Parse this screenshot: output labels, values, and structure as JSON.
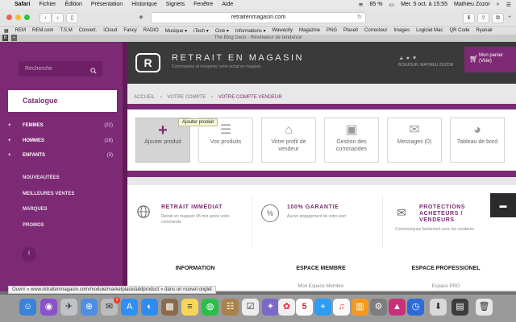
{
  "menubar": {
    "app": "Safari",
    "items": [
      "Fichier",
      "Édition",
      "Présentation",
      "Historique",
      "Signets",
      "Fenêtre",
      "Aide"
    ],
    "battery": "85 %",
    "clock": "Mer. 5 oct. à 15:55",
    "user": "Mathieu Zozor"
  },
  "browser": {
    "url": "retraitenmagasin.com",
    "tab_title": "The Blog Deco - Révélateur de tendance",
    "bookmarks": [
      "REM",
      "REM.com",
      "T.S.M",
      "Convert.",
      "iCloud",
      "Fancy",
      "RADIO",
      "Musique ▾",
      "iTech ▾",
      "Ciné ▾",
      "Informations ▾",
      "Wawacity",
      "Magazine",
      "PNG",
      "Placeit",
      "Correcteur",
      "Images",
      "Logiciel Mac",
      "QR Code",
      "Ryanair"
    ]
  },
  "sidebar": {
    "search_placeholder": "Recherche",
    "catalogue": "Catalogue",
    "categories": [
      {
        "label": "FEMMES",
        "count": "(22)"
      },
      {
        "label": "HOMMES",
        "count": "(16)"
      },
      {
        "label": "ENFANTS",
        "count": "(3)"
      }
    ],
    "links": [
      "NOUVEAUTÉES",
      "MEILLEURES VENTES",
      "MARQUES",
      "PROMOS"
    ],
    "social": "f"
  },
  "header": {
    "logo": "R",
    "title": "RETRAIT EN MAGASIN",
    "subtitle": "Commandez et récupérez votre achat en magasin",
    "user": "BONJOUR, MATHIEU ZOZOR",
    "cart_line1": "Mon panier",
    "cart_line2": "(Vide)"
  },
  "breadcrumb": [
    "ACCUEIL",
    "›",
    "VOTRE COMPTE",
    "›",
    "VOTRE COMPTE VENDEUR"
  ],
  "actions": [
    {
      "label": "Ajouter produit",
      "icon": "plus-icon"
    },
    {
      "label": "Vos produits",
      "icon": "list-icon"
    },
    {
      "label": "Votre profil de vendeur",
      "icon": "shop-icon"
    },
    {
      "label": "Gestion des commandes",
      "icon": "money-icon"
    },
    {
      "label": "Messages (0)",
      "icon": "envelope-icon"
    },
    {
      "label": "Tableau de bord",
      "icon": "dashboard-icon"
    }
  ],
  "tooltip": "Ajouter produit",
  "features": [
    {
      "title": "RETRAIT IMMÉDIAT",
      "desc": "Retrait en magasin 45 min après votre commande",
      "icon": "globe-icon"
    },
    {
      "title": "100% GARANTIE",
      "desc": "Aucun engagement de votre part",
      "icon": "percent-icon"
    },
    {
      "title": "PROTECTIONS ACHETEURS / VENDEURS",
      "desc": "Communiquez facilement avec les vendeurs",
      "icon": "mail-icon"
    }
  ],
  "footer": {
    "col1_title": "INFORMATION",
    "col2_title": "ESPACE MEMBRE",
    "col2_link": "Mon Espace Membre",
    "col3_title": "ESPACE PROFESSIONEL",
    "col3_link": "Espace PRO"
  },
  "statusbar": "Ouvrir « www.retraitenmagasin.com/module/marketplace/addproduct » dans un nouvel onglet",
  "dock": {
    "calendar_day": "5",
    "mail_badge": "3"
  }
}
